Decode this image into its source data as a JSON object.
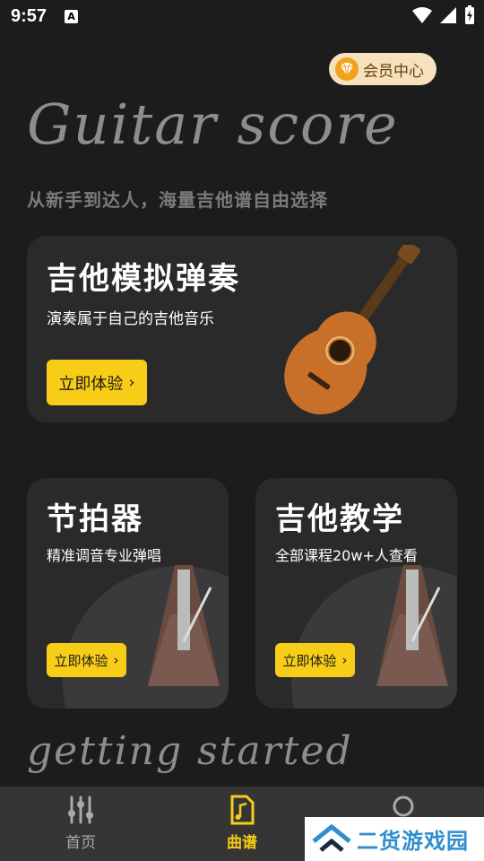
{
  "status_bar": {
    "time": "9:57",
    "notification_icon": "a-icon"
  },
  "vip": {
    "label": "会员中心",
    "icon": "diamond-icon"
  },
  "hero": {
    "title": "Guitar score",
    "subtitle": "从新手到达人，海量吉他谱自由选择"
  },
  "cards": {
    "guitar": {
      "title": "吉他模拟弹奏",
      "desc": "演奏属于自己的吉他音乐",
      "button": "立即体验"
    },
    "metronome": {
      "title": "节拍器",
      "desc": "精准调音专业弹唱",
      "button": "立即体验"
    },
    "teaching": {
      "title": "吉他教学",
      "desc": "全部课程20w+人查看",
      "button": "立即体验"
    }
  },
  "footer": {
    "script_text": "getting started"
  },
  "bottom_nav": {
    "items": [
      {
        "label": "首页",
        "icon": "sliders-icon",
        "active": false
      },
      {
        "label": "曲谱",
        "icon": "music-file-icon",
        "active": true
      },
      {
        "label": "",
        "icon": "circle-icon",
        "active": false
      }
    ]
  },
  "watermark": {
    "text": "二货游戏园"
  },
  "colors": {
    "accent": "#f7cd18",
    "background": "#1c1c1c",
    "card": "#2a2a2a",
    "vip_bg": "#f5e1bb"
  }
}
